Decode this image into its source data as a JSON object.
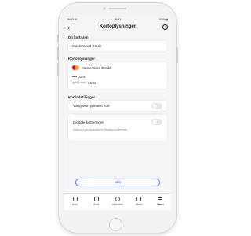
{
  "status_bar": {
    "carrier": "Wi-Fi ⦿",
    "time": "09:41",
    "battery": "100% ▮"
  },
  "header": {
    "title": "Kortoplysninger",
    "back_icon": "chevron-left-icon",
    "help_icon": "help-circle-icon"
  },
  "nickname_section": {
    "label": "Dit kortnavn",
    "value": "MasterCard Credit"
  },
  "card_info_section": {
    "label": "Kortoplysninger",
    "card_brand_icon": "mastercard-logo",
    "card_name": "MasterCard Credit",
    "card_number": "•••• 6109",
    "expiry_label": "gyldig indtil",
    "expiry_value": "02/22"
  },
  "settings_section": {
    "label": "Kortindstillinger",
    "primary_card_label": "Vælg som primært kort",
    "primary_card_enabled": false,
    "digital_receipts_label": "Digitale kvitteringer",
    "digital_receipts_enabled": false,
    "digital_receipts_note": "Dette kort kan anvendes for Storebox kvitteringer"
  },
  "delete_button": {
    "label": "Slet"
  },
  "tab_bar": {
    "items": [
      {
        "label": "Hjem",
        "icon": "home-icon"
      },
      {
        "label": "Butik",
        "icon": "shop-icon"
      },
      {
        "label": "Aktiviteter",
        "icon": "activity-icon"
      },
      {
        "label": "Aftaler",
        "icon": "agreements-icon"
      },
      {
        "label": "Menu",
        "icon": "menu-icon"
      }
    ],
    "active_index": 4
  },
  "colors": {
    "accent": "#5b6cff",
    "active_tab": "#3a2a6a",
    "mastercard_red": "#eb001b",
    "mastercard_orange": "#f79e1b"
  }
}
